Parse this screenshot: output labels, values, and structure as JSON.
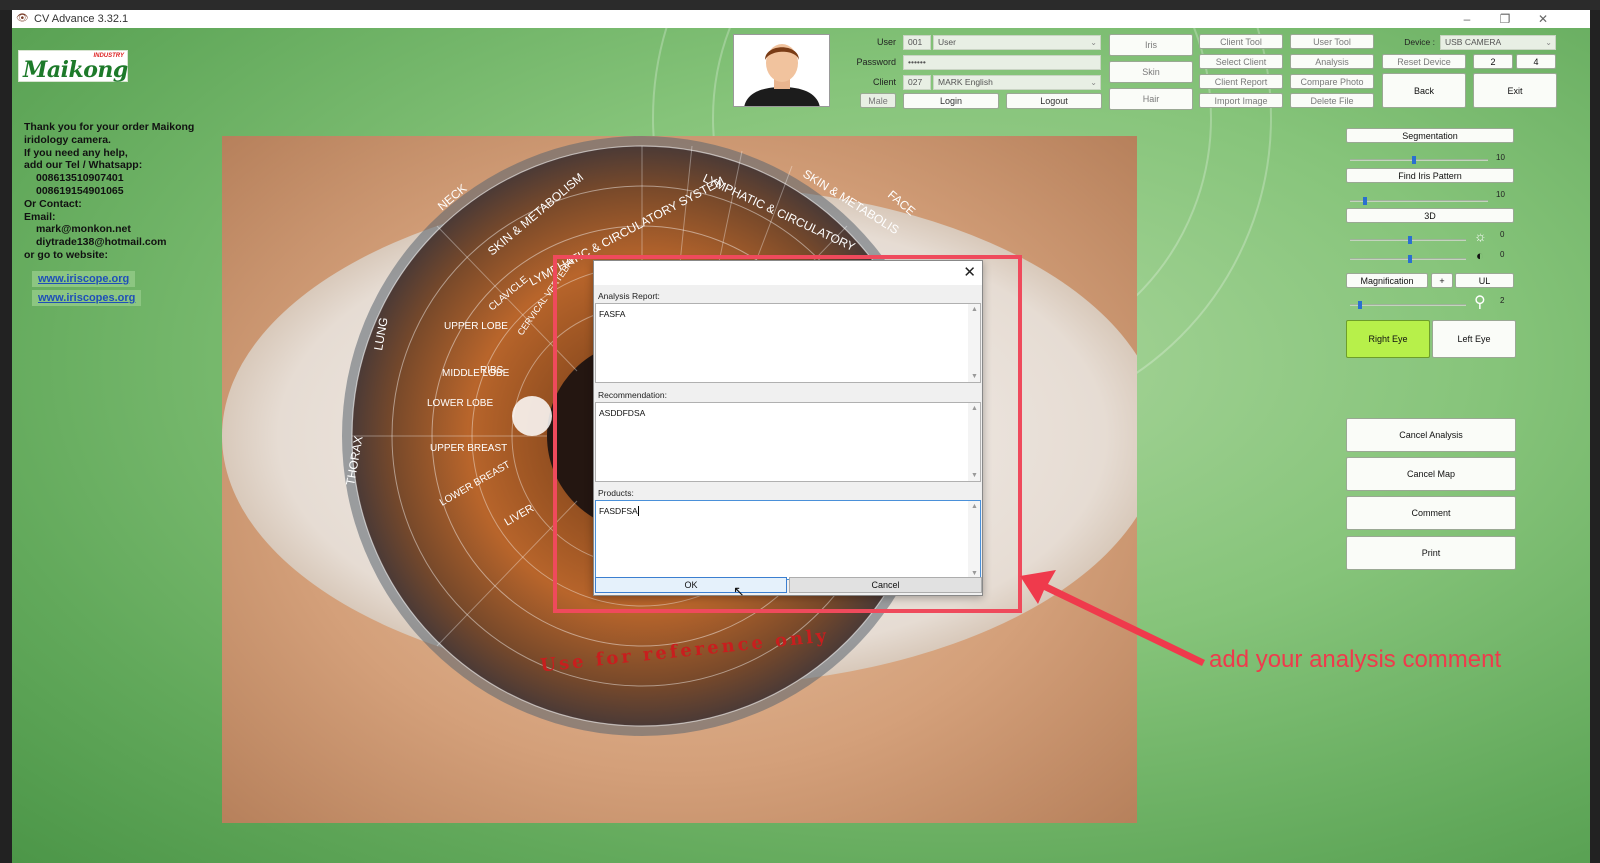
{
  "window": {
    "title": "CV Advance 3.32.1",
    "minimize": "–",
    "restore": "❐",
    "close": "✕"
  },
  "brand": {
    "logo": "Maikong",
    "logo_sub": "INDUSTRY"
  },
  "contact": {
    "lines": [
      "Thank you for your order Maikong",
      "iridology camera.",
      "If you need any help,",
      "add our  Tel / Whatsapp:",
      "008613510907401",
      "008619154901065",
      "Or Contact:",
      "Email:",
      "mark@monkon.net",
      "diytrade138@hotmail.com",
      "or go to website:"
    ],
    "links": [
      "www.iriscope.org",
      "www.iriscopes.org"
    ]
  },
  "login": {
    "user_label": "User",
    "user_code": "001",
    "user_name": "User",
    "password_label": "Password",
    "password_value": "••••••",
    "client_label": "Client",
    "client_code": "027",
    "client_name": "MARK English",
    "gender": "Male",
    "login_btn": "Login",
    "logout_btn": "Logout"
  },
  "toolbar": {
    "iris": "Iris",
    "skin": "Skin",
    "hair": "Hair",
    "client_tool": "Client Tool",
    "select_client": "Select Client",
    "client_report": "Client Report",
    "import_image": "Import Image",
    "user_tool": "User Tool",
    "analysis": "Analysis",
    "compare_photo": "Compare Photo",
    "delete_file": "Delete File",
    "device_label": "Device :",
    "device_value": "USB CAMERA",
    "reset_device": "Reset Device",
    "num_2": "2",
    "num_4": "4",
    "back": "Back",
    "exit": "Exit"
  },
  "right_panel": {
    "segmentation": "Segmentation",
    "segmentation_value": "10",
    "find_iris_pattern": "Find Iris Pattern",
    "find_iris_value": "10",
    "three_d": "3D",
    "brightness_value": "0",
    "contrast_value": "0",
    "magnification": "Magnification",
    "plus": "+",
    "ul": "UL",
    "magnification_value": "2",
    "right_eye": "Right Eye",
    "left_eye": "Left Eye",
    "cancel_analysis": "Cancel Analysis",
    "cancel_map": "Cancel Map",
    "comment": "Comment",
    "print": "Print"
  },
  "iris_chart": {
    "labels": [
      "SKIN & METABOLISM",
      "LYMPHATIC & CIRCULATORY SYSTEM",
      "NECK",
      "LUNG",
      "UPPER LOBE",
      "MIDDLE LOBE",
      "LOWER LOBE",
      "RIBS",
      "UPPER BREAST",
      "LOWER BREAST",
      "LIVER",
      "THORAX",
      "CLAVICLE",
      "CERVICAL VERTEBRA",
      "FACE",
      "LYMPHATIC & CIRCULATORY",
      "SKIN & METABOLIS"
    ],
    "watermark": "Use for reference only"
  },
  "dialog": {
    "close": "✕",
    "analysis_label": "Analysis Report:",
    "analysis_value": "FASFA",
    "recommendation_label": "Recommendation:",
    "recommendation_value": "ASDDFDSA",
    "products_label": "Products:",
    "products_value": "FASDFSA",
    "ok": "OK",
    "cancel": "Cancel"
  },
  "annotation": {
    "text": "add your analysis comment",
    "color": "#ef3a4c"
  }
}
